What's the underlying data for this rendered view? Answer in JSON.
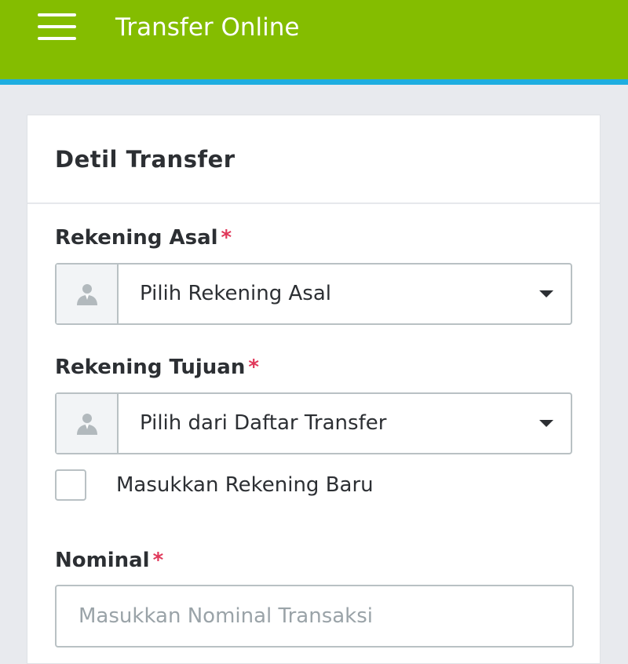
{
  "appbar": {
    "title": "Transfer Online",
    "menu_icon": "hamburger-menu-icon"
  },
  "card": {
    "title": "Detil Transfer"
  },
  "form": {
    "source_account": {
      "label": "Rekening Asal",
      "required_mark": "*",
      "icon": "user-icon",
      "selected": "Pilih Rekening Asal"
    },
    "destination_account": {
      "label": "Rekening Tujuan",
      "required_mark": "*",
      "icon": "user-icon",
      "selected": "Pilih dari Daftar Transfer"
    },
    "new_account_checkbox": {
      "label": "Masukkan Rekening Baru",
      "checked": false
    },
    "amount": {
      "label": "Nominal",
      "required_mark": "*",
      "placeholder": "Masukkan Nominal Transaksi",
      "value": ""
    }
  },
  "colors": {
    "appbar": "#84bd00",
    "appbar_underline": "#1eaee0",
    "required": "#e0385a",
    "background": "#e8eaee"
  }
}
